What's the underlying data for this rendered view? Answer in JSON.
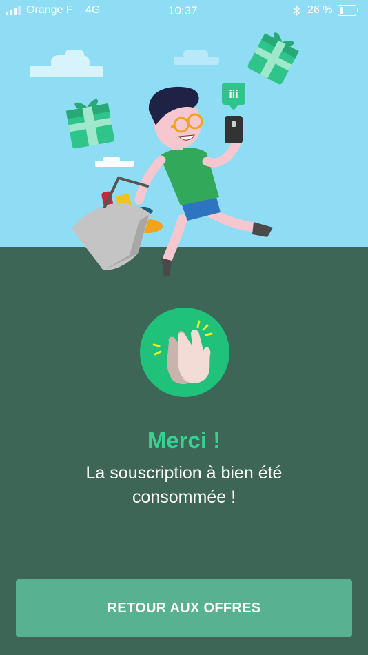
{
  "status_bar": {
    "carrier": "Orange F",
    "network": "4G",
    "time": "10:37",
    "battery_percent_text": "26 %",
    "battery_level": 0.26,
    "icons": [
      "signal-icon",
      "bluetooth-icon",
      "battery-icon"
    ]
  },
  "illustration": {
    "badge_text": "iii",
    "icons": [
      "gift-icon",
      "cloud-icon",
      "shopping-bag-icon",
      "phone-icon"
    ]
  },
  "confirmation": {
    "icon": "clapping-hands-icon",
    "title": "Merci !",
    "message": "La souscription à bien été consommée !"
  },
  "actions": {
    "back_to_offers_label": "RETOUR AUX OFFRES"
  },
  "colors": {
    "sky": "#8fdcf5",
    "ground": "#3d6657",
    "accent_green": "#35d392",
    "badge_green": "#20c17a",
    "button": "#58b190",
    "gift": "#2fc58a"
  }
}
